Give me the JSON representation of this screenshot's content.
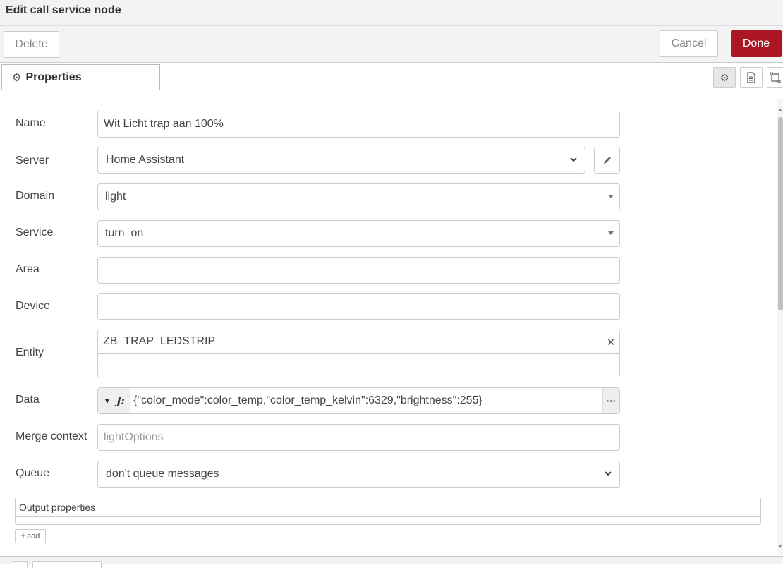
{
  "dialog": {
    "title": "Edit call service node"
  },
  "toolbar": {
    "delete_label": "Delete",
    "cancel_label": "Cancel",
    "done_label": "Done"
  },
  "tabs": {
    "properties_label": "Properties"
  },
  "side_tabs": [
    "gear-icon",
    "document-icon",
    "layout-icon"
  ],
  "form": {
    "name": {
      "label": "Name",
      "value": "Wit Licht trap aan 100%"
    },
    "server": {
      "label": "Server",
      "value": "Home Assistant"
    },
    "domain": {
      "label": "Domain",
      "value": "light"
    },
    "service": {
      "label": "Service",
      "value": "turn_on"
    },
    "area": {
      "label": "Area",
      "value": ""
    },
    "device": {
      "label": "Device",
      "value": ""
    },
    "entity": {
      "label": "Entity",
      "value": "ZB_TRAP_LEDSTRIP"
    },
    "data": {
      "label": "Data",
      "value": "{\"color_mode\":color_temp,\"color_temp_kelvin\":6329,\"brightness\":255}"
    },
    "merge_context": {
      "label": "Merge context",
      "placeholder": "lightOptions"
    },
    "queue": {
      "label": "Queue",
      "value": "don't queue messages"
    }
  },
  "output": {
    "header": "Output properties",
    "add_label": "add"
  },
  "colors": {
    "done_button": "#ad1625",
    "toolbar_bg": "#f3f3f3"
  }
}
